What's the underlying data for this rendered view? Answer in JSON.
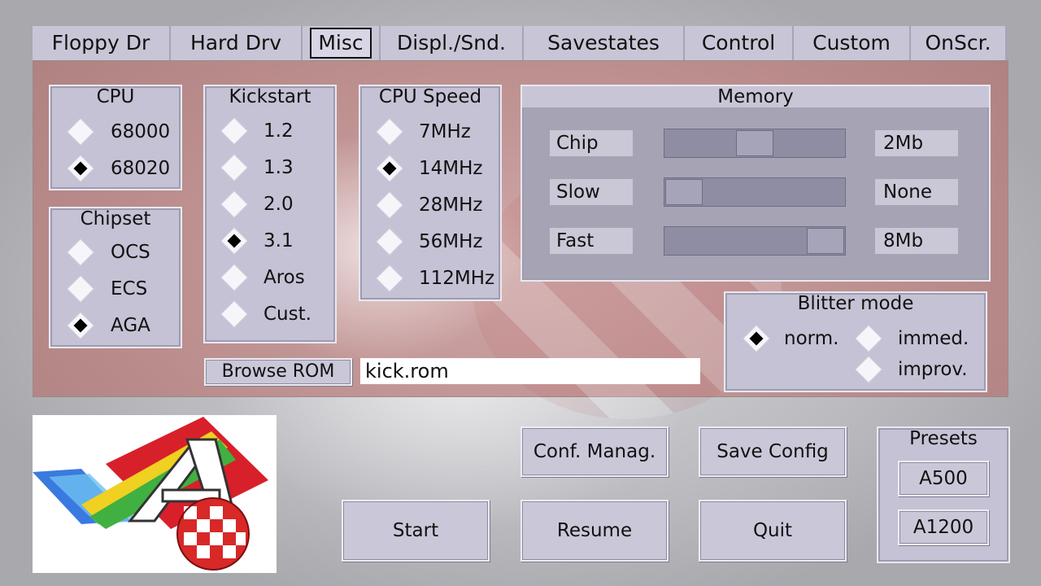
{
  "tabs": [
    {
      "label": "Floppy Dr",
      "active": false
    },
    {
      "label": "Hard Drv",
      "active": false
    },
    {
      "label": "Misc",
      "active": true
    },
    {
      "label": "Displ./Snd.",
      "active": false
    },
    {
      "label": "Savestates",
      "active": false
    },
    {
      "label": "Control",
      "active": false
    },
    {
      "label": "Custom",
      "active": false
    },
    {
      "label": "OnScr.",
      "active": false
    }
  ],
  "cpu": {
    "title": "CPU",
    "options": [
      "68000",
      "68020"
    ],
    "selected": "68020"
  },
  "chipset": {
    "title": "Chipset",
    "options": [
      "OCS",
      "ECS",
      "AGA"
    ],
    "selected": "AGA"
  },
  "kickstart": {
    "title": "Kickstart",
    "options": [
      "1.2",
      "1.3",
      "2.0",
      "3.1",
      "Aros",
      "Cust."
    ],
    "selected": "3.1"
  },
  "cpu_speed": {
    "title": "CPU Speed",
    "options": [
      "7MHz",
      "14MHz",
      "28MHz",
      "56MHz",
      "112MHz"
    ],
    "selected": "14MHz"
  },
  "memory": {
    "title": "Memory",
    "rows": [
      {
        "label": "Chip",
        "value": "2Mb",
        "level": 0.5
      },
      {
        "label": "Slow",
        "value": "None",
        "level": 0.0
      },
      {
        "label": "Fast",
        "value": "8Mb",
        "level": 1.0
      }
    ]
  },
  "blitter": {
    "title": "Blitter mode",
    "options": [
      "norm.",
      "immed.",
      "improv."
    ],
    "selected": "norm."
  },
  "rom": {
    "browse_label": "Browse ROM",
    "path": "kick.rom"
  },
  "buttons": {
    "conf_manager": "Conf. Manag.",
    "save_config": "Save Config",
    "start": "Start",
    "resume": "Resume",
    "quit": "Quit"
  },
  "presets": {
    "title": "Presets",
    "items": [
      "A500",
      "A1200"
    ]
  },
  "colors": {
    "accent": "#c8c6d6",
    "panel": "#c4a0a0",
    "logo_red": "#d8202a"
  }
}
